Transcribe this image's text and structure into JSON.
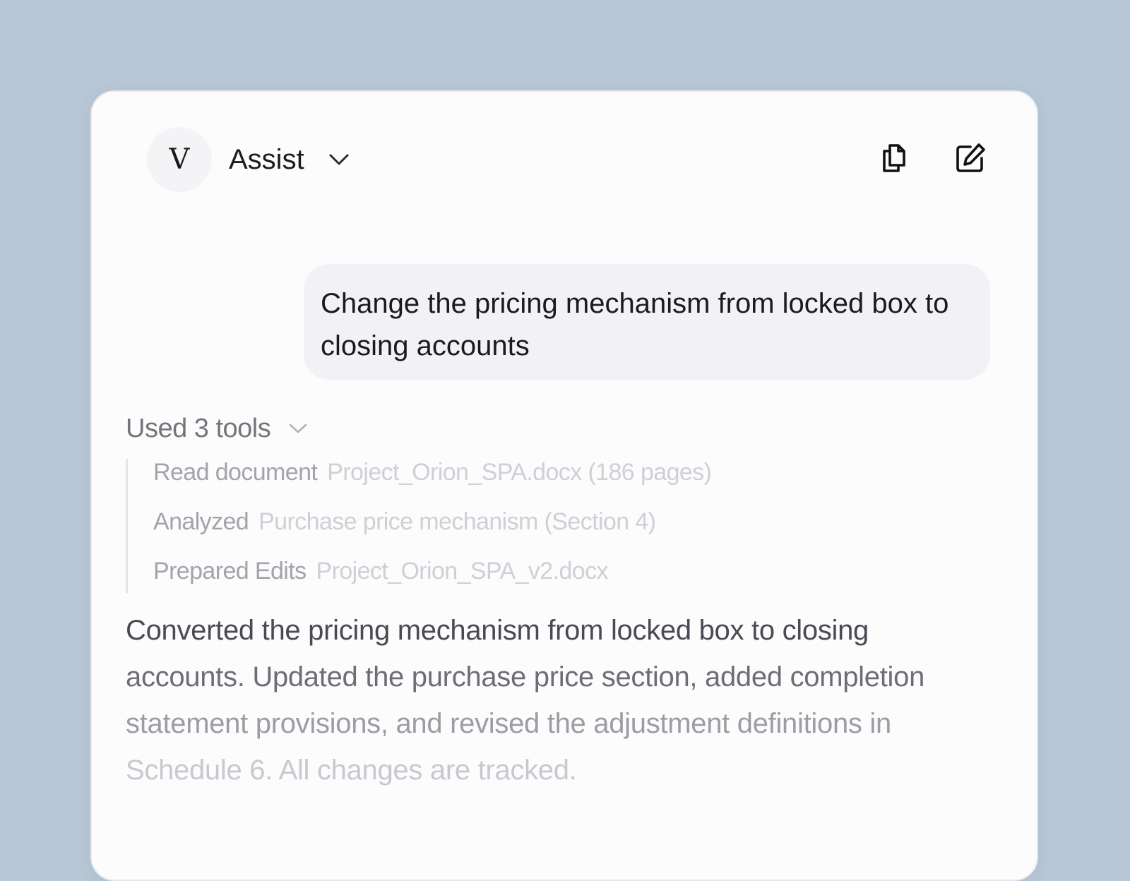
{
  "header": {
    "avatar_letter": "V",
    "assistant_name": "Assist",
    "icons": [
      "chevron-down-icon",
      "copy-icon",
      "edit-icon"
    ]
  },
  "conversation": {
    "user_message": "Change the pricing mechanism from locked box to closing accounts",
    "tools": {
      "summary": "Used 3 tools",
      "items": [
        {
          "action": "Read document",
          "target": "Project_Orion_SPA.docx (186 pages)"
        },
        {
          "action": "Analyzed",
          "target": "Purchase price mechanism (Section 4)"
        },
        {
          "action": "Prepared Edits",
          "target": "Project_Orion_SPA_v2.docx"
        }
      ]
    },
    "response_lines": [
      "Converted the pricing mechanism from locked box to closing",
      "accounts. Updated the purchase price section, added completion",
      "statement provisions, and revised the adjustment definitions in",
      "Schedule 6. All changes are tracked."
    ]
  },
  "colors": {
    "background": "#b8c7d6",
    "panel": "#fcfcfd",
    "bubble": "#f2f1f6"
  }
}
